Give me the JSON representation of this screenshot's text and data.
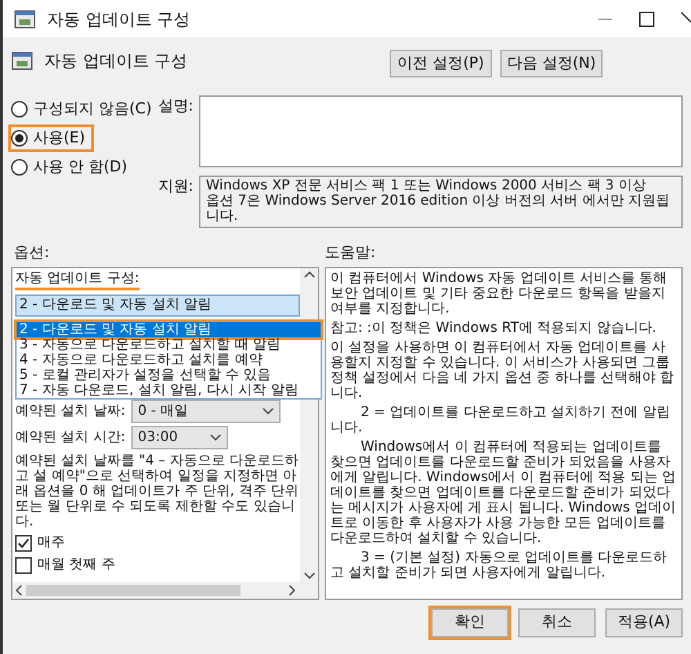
{
  "window": {
    "title": "자동 업데이트 구성"
  },
  "header": {
    "title": "자동 업데이트 구성",
    "buttons": [
      "이전 설정(P)",
      "다음 설정(N)"
    ]
  },
  "state_options": [
    {
      "label": "구성되지 않음(C)",
      "selected": false,
      "highlighted": false
    },
    {
      "label": "사용(E)",
      "selected": true,
      "highlighted": true
    },
    {
      "label": "사용 안 함(D)",
      "selected": false,
      "highlighted": false
    }
  ],
  "comment": {
    "label": "설명:"
  },
  "supported": {
    "label": "지원:",
    "lines": [
      "Windows XP 전문 서비스 팩 1 또는 Windows 2000 서비스 팩 3 이상",
      "옵션 7은 Windows Server 2016 edition 이상 버전의 서버 에서만 지원됩니다."
    ]
  },
  "options": {
    "heading": "옵션:",
    "config_label": "자동 업데이트 구성:",
    "config_value": "2 - 다운로드 및 자동 설치 알림",
    "dropdown_items": [
      {
        "label": "2 - 다운로드 및 자동 설치 알림",
        "selected": true,
        "highlighted": true
      },
      {
        "label": "3 - 자동으로 다운로드하고 설치할 때 알림",
        "selected": false,
        "highlighted": false
      },
      {
        "label": "4 - 자동으로 다운로드하고 설치를 예약",
        "selected": false,
        "highlighted": false
      },
      {
        "label": "5 - 로컬 관리자가 설정을 선택할 수 있음",
        "selected": false,
        "highlighted": false
      },
      {
        "label": "7 - 자동 다운로드, 설치 알림, 다시 시작 알림",
        "selected": false,
        "highlighted": false
      }
    ],
    "install_day": {
      "label": "예약된 설치 날짜:",
      "value": "0 - 매일"
    },
    "install_time": {
      "label": "예약된 설치 시간:",
      "value": "03:00"
    },
    "note": "예약된 설치 날짜를 \"4 – 자동으로 다운로드하고 설 예약\"으로 선택하여 일정을 지정하면 아래 옵션을 0 해 업데이트가 주 단위, 격주 단위 또는 월 단위로 수 되도록 제한할 수도 있습니다.",
    "checkboxes": [
      {
        "label": "매주",
        "checked": true
      },
      {
        "label": "매월 첫째 주",
        "checked": false
      }
    ]
  },
  "help": {
    "heading": "도움말:",
    "paragraphs": [
      {
        "text": "이 컴퓨터에서 Windows 자동 업데이트 서비스를 통해 보안 업데이트 및 기타 중요한 다운로드 항목을 받을지 여부를 지정합니다.",
        "indent": false
      },
      {
        "text": "참고: :이 정책은 Windows RT에 적용되지 않습니다.",
        "indent": false
      },
      {
        "text": "이 설정을 사용하면 이 컴퓨터에서 자동 업데이트를 사용할지 지정할 수 있습니다. 이 서비스가 사용되면 그룹 정책 설정에서 다음 네 가지 옵션 중 하나를 선택해야 합니다.",
        "indent": false
      },
      {
        "text": "2 = 업데이트를 다운로드하고 설치하기 전에 알립니다.",
        "indent": true
      },
      {
        "text": "Windows에서 이 컴퓨터에 적용되는 업데이트를 찾으면 업데이트를 다운로드할 준비가 되었음을 사용자에게 알립니다. Windows에서 이 컴퓨터에 적용 되는 업데이트를 찾으면 업데이트를 다운로드할 준비가 되었다는 메시지가 사용자에 게 표시 됩니다. Windows 업데이트로 이동한 후 사용자가 사용 가능한 모든 업데이트를 다운로드하여 설치할 수 있습니다.",
        "indent": true
      },
      {
        "text": "3 = (기본 설정) 자동으로 업데이트를 다운로드하고 설치할 준비가 되면 사용자에게 알립니다.",
        "indent": true
      }
    ]
  },
  "buttons": [
    {
      "label": "확인",
      "highlighted": true
    },
    {
      "label": "취소",
      "highlighted": false
    },
    {
      "label": "적용(A)",
      "highlighted": false
    }
  ]
}
